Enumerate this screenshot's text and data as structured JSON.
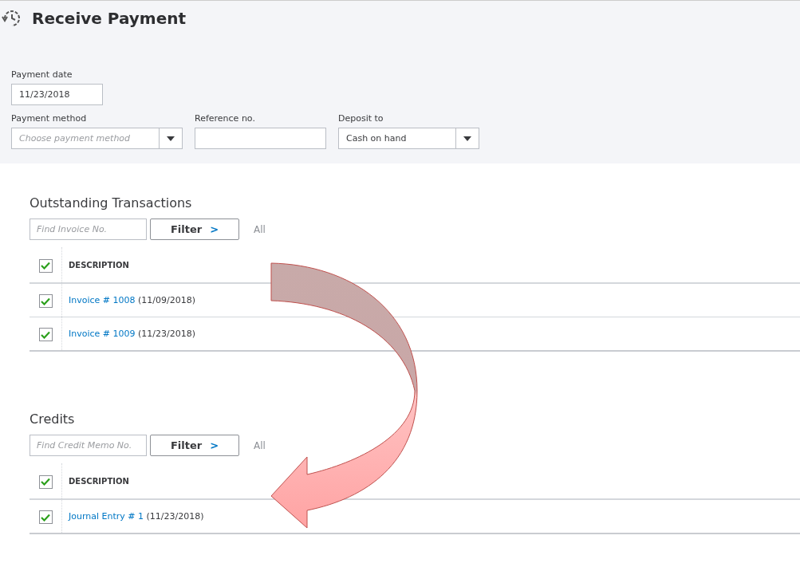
{
  "page": {
    "title": "Receive Payment"
  },
  "form": {
    "payment_date": {
      "label": "Payment date",
      "value": "11/23/2018"
    },
    "payment_method": {
      "label": "Payment method",
      "placeholder": "Choose payment method"
    },
    "reference_no": {
      "label": "Reference no."
    },
    "deposit_to": {
      "label": "Deposit to",
      "value": "Cash on hand"
    }
  },
  "sections": [
    {
      "title": "Outstanding Transactions",
      "search": {
        "placeholder": "Find Invoice No."
      },
      "filter_button": "Filter",
      "filter_caret": ">",
      "all_label": "All",
      "header": {
        "checked": true,
        "column": "DESCRIPTION"
      },
      "rows": [
        {
          "checked": true,
          "link": "Invoice # 1008",
          "date": "(11/09/2018)"
        },
        {
          "checked": true,
          "link": "Invoice # 1009",
          "date": "(11/23/2018)"
        }
      ]
    },
    {
      "title": "Credits",
      "search": {
        "placeholder": "Find Credit Memo No."
      },
      "filter_button": "Filter",
      "filter_caret": ">",
      "all_label": "All",
      "header": {
        "checked": true,
        "column": "DESCRIPTION"
      },
      "rows": [
        {
          "checked": true,
          "link": "Journal Entry # 1",
          "date": "(11/23/2018)"
        }
      ]
    }
  ]
}
